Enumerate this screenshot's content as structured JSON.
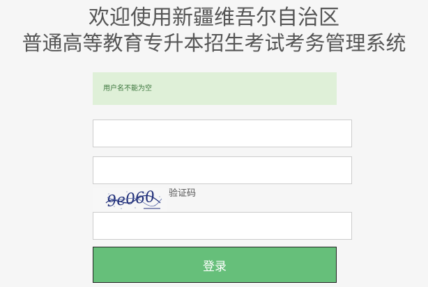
{
  "header": {
    "title_line1": "欢迎使用新疆维吾尔自治区",
    "title_line2": "普通高等教育专升本招生考试考务管理系统"
  },
  "alert": {
    "message": "用户名不能为空"
  },
  "form": {
    "username_value": "",
    "password_value": "",
    "captcha_value": "",
    "captcha_label": "验证码",
    "captcha_text": "9e060",
    "login_label": "登录"
  },
  "colors": {
    "alert_bg": "#dff0d8",
    "alert_text": "#3c763d",
    "button_bg": "#66bf7a"
  }
}
